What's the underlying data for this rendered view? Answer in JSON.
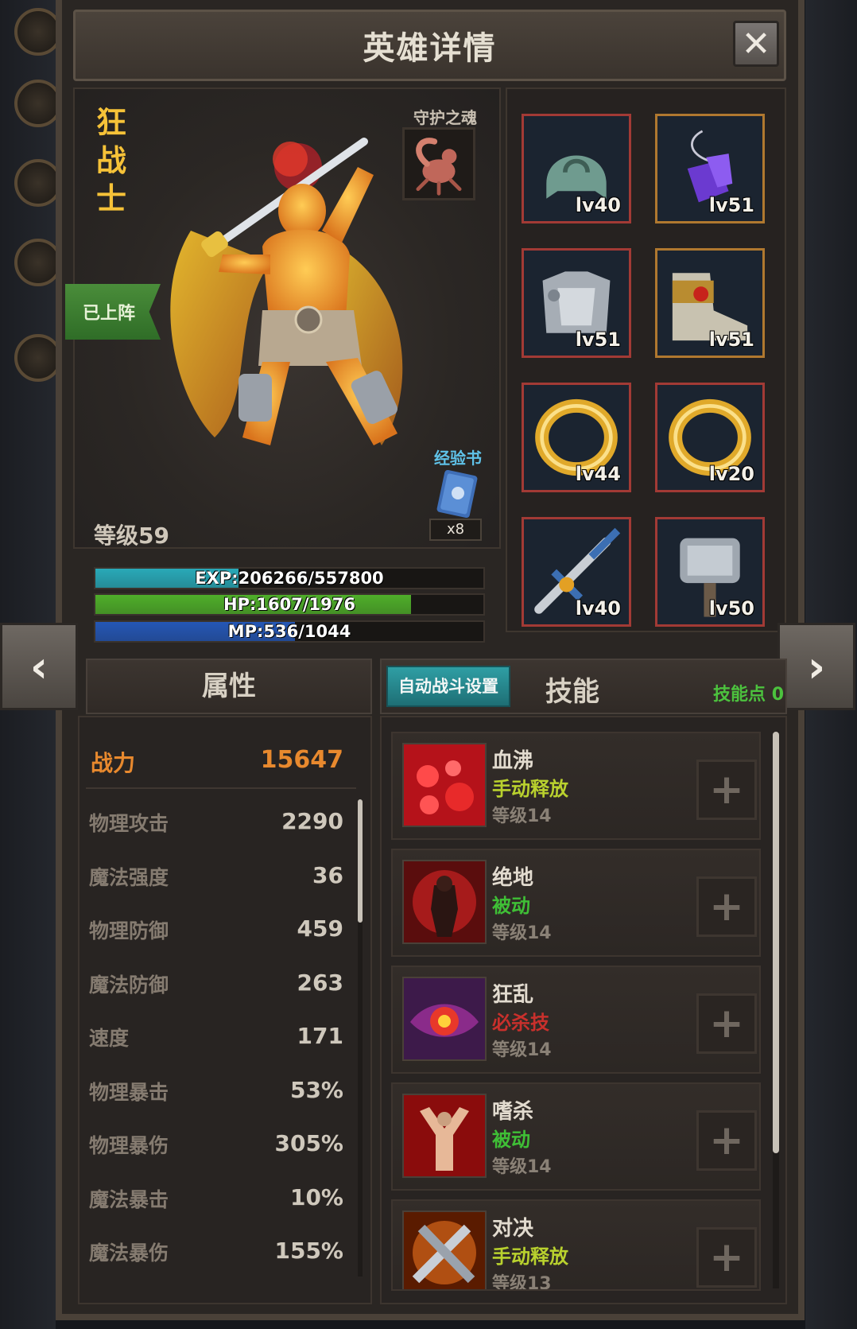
{
  "window": {
    "title": "英雄详情",
    "close_icon": "close-icon"
  },
  "hero": {
    "name_chars": [
      "狂",
      "战",
      "士"
    ],
    "deployed_badge": "已上阵",
    "soul_label": "守护之魂",
    "book_label": "经验书",
    "book_count": "x8",
    "level_label": "等级59"
  },
  "bars": {
    "exp": {
      "text": "EXP:206266/557800",
      "current": 206266,
      "max": 557800,
      "color": "#29a9b8"
    },
    "hp": {
      "text": "HP:1607/1976",
      "current": 1607,
      "max": 1976,
      "color": "#4fae2a"
    },
    "mp": {
      "text": "MP:536/1044",
      "current": 536,
      "max": 1044,
      "color": "#2557b5"
    }
  },
  "equipment": [
    {
      "icon": "helmet-icon",
      "level": "lv40",
      "frame": "red"
    },
    {
      "icon": "amulet-icon",
      "level": "lv51",
      "frame": "gold"
    },
    {
      "icon": "armor-icon",
      "level": "lv51",
      "frame": "red"
    },
    {
      "icon": "boots-icon",
      "level": "lv51",
      "frame": "gold"
    },
    {
      "icon": "ring-icon",
      "level": "lv44",
      "frame": "red"
    },
    {
      "icon": "ring-icon",
      "level": "lv20",
      "frame": "red"
    },
    {
      "icon": "sword-icon",
      "level": "lv40",
      "frame": "red"
    },
    {
      "icon": "hammer-icon",
      "level": "lv50",
      "frame": "red"
    }
  ],
  "tabs": {
    "attributes": "属性",
    "auto_battle": "自动战斗设置",
    "skills": "技能",
    "skill_points": "技能点 0"
  },
  "power": {
    "label": "战力",
    "value": "15647"
  },
  "attributes": [
    {
      "name": "物理攻击",
      "value": "2290"
    },
    {
      "name": "魔法强度",
      "value": "36"
    },
    {
      "name": "物理防御",
      "value": "459"
    },
    {
      "name": "魔法防御",
      "value": "263"
    },
    {
      "name": "速度",
      "value": "171"
    },
    {
      "name": "物理暴击",
      "value": "53%"
    },
    {
      "name": "物理暴伤",
      "value": "305%"
    },
    {
      "name": "魔法暴击",
      "value": "10%"
    },
    {
      "name": "魔法暴伤",
      "value": "155%"
    }
  ],
  "skills": [
    {
      "icon": "blood-boil-icon",
      "name": "血沸",
      "type": "手动释放",
      "type_color": "#b9d12e",
      "level": "等级14"
    },
    {
      "icon": "last-stand-icon",
      "name": "绝地",
      "type": "被动",
      "type_color": "#3fbf36",
      "level": "等级14"
    },
    {
      "icon": "frenzy-eye-icon",
      "name": "狂乱",
      "type": "必杀技",
      "type_color": "#c9302c",
      "level": "等级14"
    },
    {
      "icon": "bloodlust-icon",
      "name": "嗜杀",
      "type": "被动",
      "type_color": "#3fbf36",
      "level": "等级14"
    },
    {
      "icon": "duel-swords-icon",
      "name": "对决",
      "type": "手动释放",
      "type_color": "#b9d12e",
      "level": "等级13"
    }
  ],
  "nav": {
    "prev_icon": "chevron-left-icon",
    "next_icon": "chevron-right-icon"
  },
  "skill_add_glyph": "+"
}
